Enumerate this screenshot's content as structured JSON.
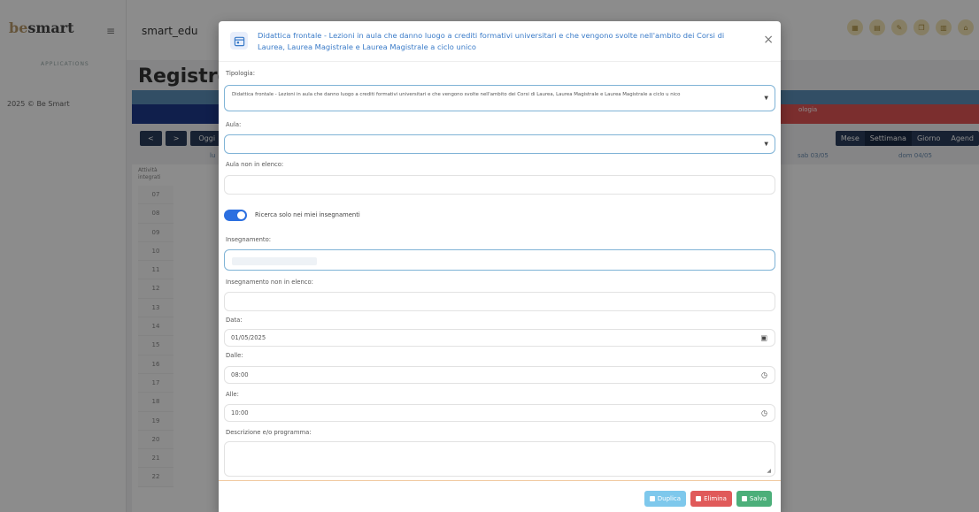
{
  "sidebar": {
    "logo_be": "be",
    "logo_smart": "smart",
    "apps_label": "APPLICATIONS",
    "copyright": "2025 © Be Smart"
  },
  "topbar": {
    "app_title": "smart_edu"
  },
  "page": {
    "title": "Registro a",
    "red_band_text": "ologia",
    "nav_prev": "<",
    "nav_next": ">",
    "nav_today": "Oggi",
    "views": [
      "Mese",
      "Settimana",
      "Giorno",
      "Agend"
    ],
    "col_left": "lu",
    "col_sat": "sab 03/05",
    "col_sun": "dom 04/05",
    "attivita_label": "Attività integrati",
    "hours": [
      "07",
      "08",
      "09",
      "10",
      "11",
      "12",
      "13",
      "14",
      "15",
      "16",
      "17",
      "18",
      "19",
      "20",
      "21",
      "22"
    ]
  },
  "modal": {
    "title": "Didattica frontale - Lezioni in aula che danno luogo a crediti formativi universitari e che vengono svolte nell'ambito dei Corsi di Laurea, Laurea Magistrale e Laurea Magistrale a ciclo unico",
    "close": "×",
    "tipologia_label": "Tipologia:",
    "tipologia_value": "Didattica frontale - Lezioni in aula che danno luogo a crediti formativi universitari e che vengono svolte nell'ambito dei Corsi di Laurea, Laurea Magistrale e Laurea Magistrale a ciclo u nico",
    "aula_label": "Aula:",
    "aula_value": "",
    "aula_non_label": "Aula non in elenco:",
    "aula_non_value": "",
    "toggle_label": "Ricerca solo nei miei insegnamenti",
    "toggle_on": true,
    "insegnamento_label": "Insegnamento:",
    "insegnamento_non_label": "Insegnamento non in elenco:",
    "data_label": "Data:",
    "data_value": "01/05/2025",
    "dalle_label": "Dalle:",
    "dalle_value": "08:00",
    "alle_label": "Alle:",
    "alle_value": "10:00",
    "descrizione_label": "Descrizione e/o programma:",
    "descrizione_value": "",
    "buttons": {
      "duplica": "Duplica",
      "elimina": "Elimina",
      "salva": "Salva"
    }
  },
  "colors": {
    "accent": "#3a7bc8",
    "toggle": "#2b6fe0",
    "duplica": "#7ec8ec",
    "elimina": "#e05a5a",
    "salva": "#4caf7a"
  }
}
